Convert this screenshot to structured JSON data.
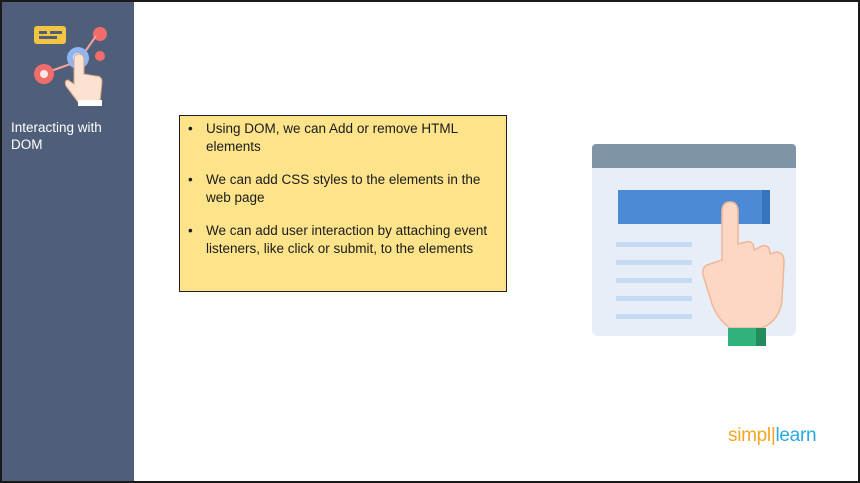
{
  "sidebar": {
    "title": "Interacting with DOM",
    "icon": "touch-interaction-icon"
  },
  "content": {
    "bullets": [
      "Using DOM, we can Add or remove HTML elements",
      "We can add CSS styles to the elements in the web page",
      "We can add user interaction by attaching event listeners, like click or submit, to the elements"
    ]
  },
  "illustration": {
    "icon": "webpage-click-illustration"
  },
  "logo": {
    "part1": "simpl",
    "part2": "learn"
  },
  "colors": {
    "sidebar": "#4f5e79",
    "box": "#fde38a",
    "accent_orange": "#f5a623",
    "accent_blue": "#2aa8e0"
  }
}
